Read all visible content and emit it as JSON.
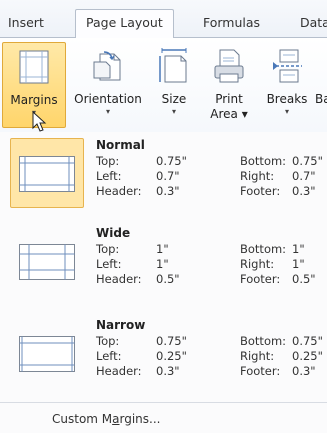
{
  "tabs": [
    {
      "label": "Insert",
      "active": false
    },
    {
      "label": "Page Layout",
      "active": true
    },
    {
      "label": "Formulas",
      "active": false
    },
    {
      "label": "Data",
      "active": false
    }
  ],
  "ribbon": {
    "buttons": [
      {
        "label": "Margins",
        "arrow": "▾",
        "icon": "margins-icon",
        "active": true
      },
      {
        "label": "Orientation",
        "arrow": "▾",
        "icon": "orientation-icon",
        "active": false
      },
      {
        "label": "Size",
        "arrow": "▾",
        "icon": "size-icon",
        "active": false
      },
      {
        "label": "Print",
        "label2": "Area ▾",
        "icon": "print-area-icon",
        "active": false
      },
      {
        "label": "Breaks",
        "arrow": "▾",
        "icon": "breaks-icon",
        "active": false
      },
      {
        "label": "Ba",
        "icon": "",
        "active": false
      }
    ]
  },
  "margins_menu": {
    "items": [
      {
        "name": "Normal",
        "top_label": "Top:",
        "top": "0.75\"",
        "bottom_label": "Bottom:",
        "bottom": "0.75\"",
        "left_label": "Left:",
        "left": "0.7\"",
        "right_label": "Right:",
        "right": "0.7\"",
        "header_label": "Header:",
        "header": "0.3\"",
        "footer_label": "Footer:",
        "footer": "0.3\"",
        "selected": true
      },
      {
        "name": "Wide",
        "top_label": "Top:",
        "top": "1\"",
        "bottom_label": "Bottom:",
        "bottom": "1\"",
        "left_label": "Left:",
        "left": "1\"",
        "right_label": "Right:",
        "right": "1\"",
        "header_label": "Header:",
        "header": "0.5\"",
        "footer_label": "Footer:",
        "footer": "0.5\"",
        "selected": false
      },
      {
        "name": "Narrow",
        "top_label": "Top:",
        "top": "0.75\"",
        "bottom_label": "Bottom:",
        "bottom": "0.75\"",
        "left_label": "Left:",
        "left": "0.25\"",
        "right_label": "Right:",
        "right": "0.25\"",
        "header_label": "Header:",
        "header": "0.3\"",
        "footer_label": "Footer:",
        "footer": "0.3\"",
        "selected": false
      }
    ],
    "custom_pre": "Custom M",
    "custom_accel": "a",
    "custom_post": "rgins..."
  }
}
